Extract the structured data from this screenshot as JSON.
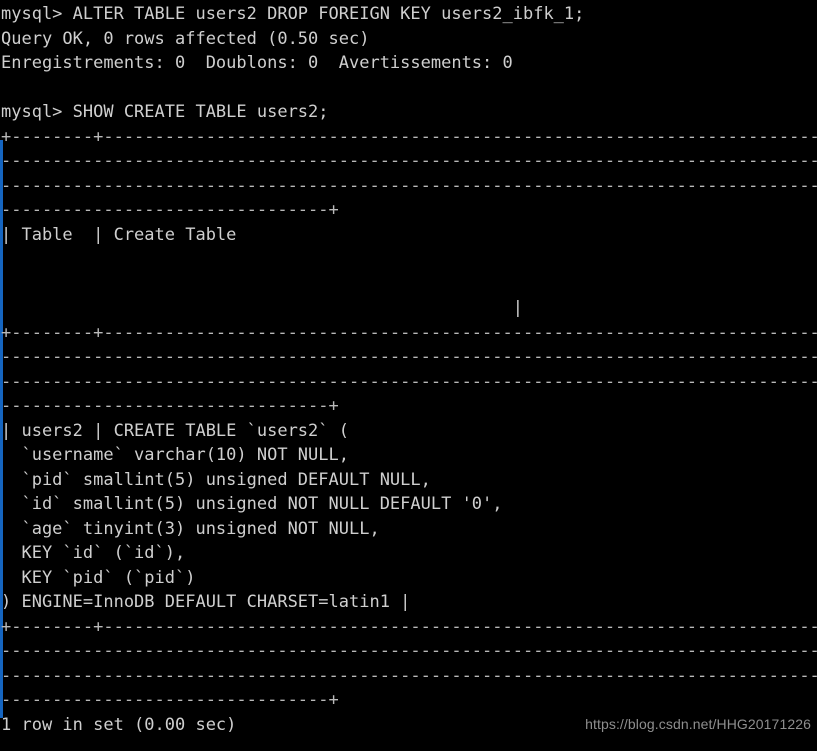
{
  "terminal": {
    "prompt": "mysql>",
    "background_color": "#000000",
    "text_color": "#cfcfcf",
    "rule_color": "#b9b9b9",
    "gutter_color": "#1565c0",
    "font_size_px": 17,
    "line_height_px": 24.5,
    "columns": 85,
    "lines": [
      {
        "id": "l01",
        "kind": "command",
        "text": "mysql> ALTER TABLE users2 DROP FOREIGN KEY users2_ibfk_1;"
      },
      {
        "id": "l02",
        "kind": "output",
        "text": "Query OK, 0 rows affected (0.50 sec)"
      },
      {
        "id": "l03",
        "kind": "output",
        "text": "Enregistrements: 0  Doublons: 0  Avertissements: 0"
      },
      {
        "id": "l04",
        "kind": "blank",
        "text": ""
      },
      {
        "id": "l05",
        "kind": "command",
        "text": "mysql> SHOW CREATE TABLE users2;"
      },
      {
        "id": "l06",
        "kind": "rule",
        "text": "+--------+-------------------------------------------------------------------------"
      },
      {
        "id": "l07",
        "kind": "rule",
        "text": "-------------------------------------------------------------------------------------"
      },
      {
        "id": "l08",
        "kind": "rule",
        "text": "-------------------------------------------------------------------------------------"
      },
      {
        "id": "l09",
        "kind": "rule",
        "text": "--------------------------------+"
      },
      {
        "id": "l10",
        "kind": "output",
        "text": "| Table  | Create Table"
      },
      {
        "id": "l11",
        "kind": "blank",
        "text": ""
      },
      {
        "id": "l12",
        "kind": "blank",
        "text": ""
      },
      {
        "id": "l13",
        "kind": "output",
        "text": "                                                  |"
      },
      {
        "id": "l14",
        "kind": "rule",
        "text": "+--------+-------------------------------------------------------------------------"
      },
      {
        "id": "l15",
        "kind": "rule",
        "text": "-------------------------------------------------------------------------------------"
      },
      {
        "id": "l16",
        "kind": "rule",
        "text": "-------------------------------------------------------------------------------------"
      },
      {
        "id": "l17",
        "kind": "rule",
        "text": "--------------------------------+"
      },
      {
        "id": "l18",
        "kind": "output",
        "text": "| users2 | CREATE TABLE `users2` ("
      },
      {
        "id": "l19",
        "kind": "output",
        "text": "  `username` varchar(10) NOT NULL,"
      },
      {
        "id": "l20",
        "kind": "output",
        "text": "  `pid` smallint(5) unsigned DEFAULT NULL,"
      },
      {
        "id": "l21",
        "kind": "output",
        "text": "  `id` smallint(5) unsigned NOT NULL DEFAULT '0',"
      },
      {
        "id": "l22",
        "kind": "output",
        "text": "  `age` tinyint(3) unsigned NOT NULL,"
      },
      {
        "id": "l23",
        "kind": "output",
        "text": "  KEY `id` (`id`),"
      },
      {
        "id": "l24",
        "kind": "output",
        "text": "  KEY `pid` (`pid`)"
      },
      {
        "id": "l25",
        "kind": "output",
        "text": ") ENGINE=InnoDB DEFAULT CHARSET=latin1 |"
      },
      {
        "id": "l26",
        "kind": "rule",
        "text": "+--------+-------------------------------------------------------------------------"
      },
      {
        "id": "l27",
        "kind": "rule",
        "text": "-------------------------------------------------------------------------------------"
      },
      {
        "id": "l28",
        "kind": "rule",
        "text": "-------------------------------------------------------------------------------------"
      },
      {
        "id": "l29",
        "kind": "rule",
        "text": "--------------------------------+"
      },
      {
        "id": "l30",
        "kind": "output",
        "text": "1 row in set (0.00 sec)"
      }
    ],
    "watermark": "https://blog.csdn.net/HHG20171226"
  }
}
